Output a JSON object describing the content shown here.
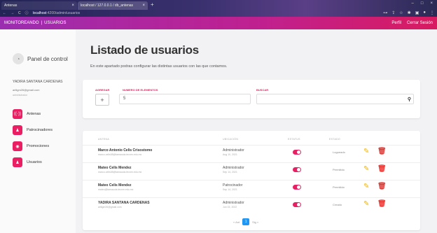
{
  "browser": {
    "tabs": [
      {
        "label": "Antenas"
      },
      {
        "label": "localhost / 127.0.0.1 / db_antenas"
      }
    ],
    "url_host": "localhost",
    "url_path": ":4200/admin/usuarios"
  },
  "appbar": {
    "brand": "MONITOREANDO",
    "section": "USUARIOS",
    "profile": "Perfil",
    "logout": "Cerrar Sesión"
  },
  "sidebar": {
    "panel_title": "Panel de control",
    "user_name": "YADIRA SANTANA CARDENAS",
    "user_email": "ariligm26@gmail.com",
    "user_role": "administrador",
    "items": [
      {
        "label": "Antenas"
      },
      {
        "label": "Patrocinadores"
      },
      {
        "label": "Promociones"
      },
      {
        "label": "Usuarios"
      }
    ]
  },
  "main": {
    "title": "Listado de usuarios",
    "description": "En este apartado podras configurar las distintas usuarios con las que contamos.",
    "filters": {
      "add_label": "AGREGAR",
      "add_symbol": "+",
      "num_label": "NUMERO DE ELEMENTOS",
      "num_value": "5",
      "search_label": "BUSCAR",
      "search_value": ""
    },
    "table": {
      "headers": [
        "ANTENA",
        "UBICACIÓN",
        "ESTATUS",
        "ESTADO"
      ],
      "rows": [
        {
          "name": "Marco Antonio Celis Crisostomo",
          "email": "marco.celis08@tamaucla.tecnm.edu.mx",
          "role": "Administrador",
          "date": "Aug 10, 2021",
          "status": "Logueado"
        },
        {
          "name": "Mateo Celis Mendez",
          "email": "marco.celis08@tamaucla.tecnm.edu.mx",
          "role": "Administrador",
          "date": "Sep 14, 2021",
          "status": "Permitido"
        },
        {
          "name": "Mateo Celis Mendez",
          "email": "mateo@tamaucla.tecnm.edu.mx",
          "role": "Patrocinador",
          "date": "Sep 14, 2021",
          "status": "Permitido"
        },
        {
          "name": "YADIRA SANTANA CARDENAS",
          "email": "ariligm26@gmail.com",
          "role": "Administrador",
          "date": "Jun 15, 2022",
          "status": "Creado"
        }
      ]
    },
    "pagination": {
      "prev": "« Ant",
      "current": "1",
      "next": "Sig »"
    }
  },
  "colors": {
    "accent": "#e91e63",
    "appbar_start": "#9b2db0",
    "appbar_end": "#d81b60",
    "edit": "#f4b400",
    "delete": "#e53935",
    "page_active": "#2196f3"
  }
}
